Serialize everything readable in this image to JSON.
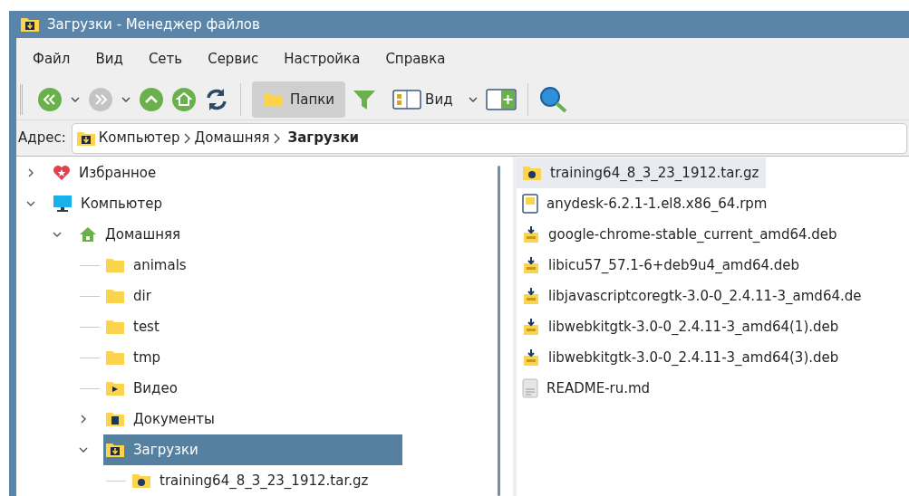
{
  "window": {
    "title": "Загрузки - Менеджер файлов"
  },
  "menu": [
    "Файл",
    "Вид",
    "Сеть",
    "Сервис",
    "Настройка",
    "Справка"
  ],
  "toolbar": {
    "folders_button": {
      "label": "Папки",
      "selected": true
    },
    "view_button": {
      "label": "Вид"
    }
  },
  "address": {
    "label": "Адрес:",
    "path": [
      {
        "label": "Компьютер"
      },
      {
        "label": "Домашняя"
      },
      {
        "label": "Загрузки"
      }
    ]
  },
  "tree": [
    {
      "label": "Избранное",
      "kind": "favorites",
      "expanded": false,
      "selected": false
    },
    {
      "label": "Компьютер",
      "kind": "computer",
      "expanded": true,
      "selected": false,
      "children": [
        {
          "label": "Домашняя",
          "kind": "home",
          "expanded": true,
          "selected": false,
          "children": [
            {
              "label": "animals",
              "kind": "folder",
              "selected": false
            },
            {
              "label": "dir",
              "kind": "folder",
              "selected": false
            },
            {
              "label": "test",
              "kind": "folder",
              "selected": false
            },
            {
              "label": "tmp",
              "kind": "folder",
              "selected": false
            },
            {
              "label": "Видео",
              "kind": "video",
              "selected": false
            },
            {
              "label": "Документы",
              "kind": "documents",
              "expanded": false,
              "selected": false
            },
            {
              "label": "Загрузки",
              "kind": "downloads",
              "expanded": true,
              "selected": true,
              "children": [
                {
                  "label": "training64_8_3_23_1912.tar.gz",
                  "kind": "archive",
                  "selected": false
                }
              ]
            }
          ]
        }
      ]
    }
  ],
  "files": [
    {
      "name": "training64_8_3_23_1912.tar.gz",
      "kind": "archive",
      "selected": true
    },
    {
      "name": "anydesk-6.2.1-1.el8.x86_64.rpm",
      "kind": "rpm",
      "selected": false
    },
    {
      "name": "google-chrome-stable_current_amd64.deb",
      "kind": "deb",
      "selected": false
    },
    {
      "name": "libicu57_57.1-6+deb9u4_amd64.deb",
      "kind": "deb",
      "selected": false
    },
    {
      "name": "libjavascriptcoregtk-3.0-0_2.4.11-3_amd64.de",
      "kind": "deb",
      "selected": false
    },
    {
      "name": "libwebkitgtk-3.0-0_2.4.11-3_amd64(1).deb",
      "kind": "deb",
      "selected": false
    },
    {
      "name": "libwebkitgtk-3.0-0_2.4.11-3_amd64(3).deb",
      "kind": "deb",
      "selected": false
    },
    {
      "name": "README-ru.md",
      "kind": "text",
      "selected": false
    }
  ]
}
